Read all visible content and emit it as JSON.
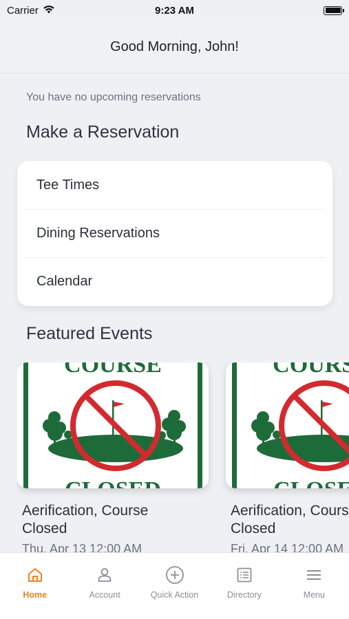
{
  "status_bar": {
    "carrier": "Carrier",
    "time": "9:23 AM"
  },
  "header": {
    "greeting": "Good Morning, John!"
  },
  "reservations": {
    "empty_message": "You have no upcoming reservations",
    "section_title": "Make a Reservation",
    "items": [
      {
        "label": "Tee Times"
      },
      {
        "label": "Dining Reservations"
      },
      {
        "label": "Calendar"
      }
    ]
  },
  "events": {
    "section_title": "Featured Events",
    "items": [
      {
        "title": "Aerification, Course\nClosed",
        "date": "Thu, Apr 13 12:00 AM",
        "image": "course-closed-sign"
      },
      {
        "title": "Aerification, Course\nClosed",
        "date": "Fri, Apr 14 12:00 AM",
        "image": "course-closed-sign"
      }
    ]
  },
  "tab_bar": {
    "active": "home",
    "accent_color": "#f0821e",
    "inactive_color": "#8b8f99",
    "tabs": [
      {
        "id": "home",
        "label": "Home",
        "icon": "home-icon"
      },
      {
        "id": "account",
        "label": "Account",
        "icon": "person-icon"
      },
      {
        "id": "quick_action",
        "label": "Quick Action",
        "icon": "plus-circle-icon"
      },
      {
        "id": "directory",
        "label": "Directory",
        "icon": "list-icon"
      },
      {
        "id": "menu",
        "label": "Menu",
        "icon": "hamburger-icon"
      }
    ]
  },
  "sign_text": {
    "top": "COURSE",
    "bottom": "CLOSED"
  }
}
